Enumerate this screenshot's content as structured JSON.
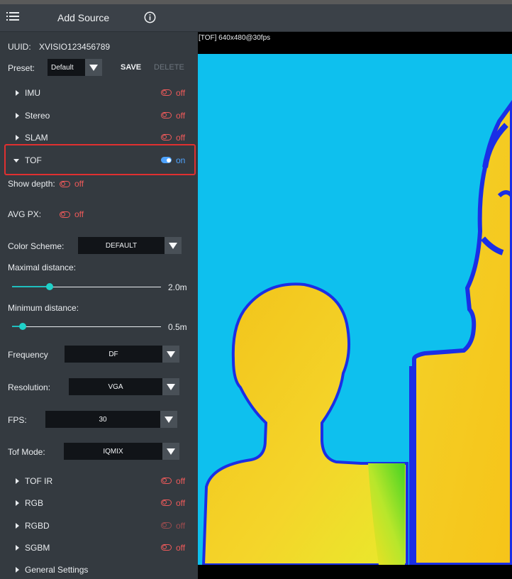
{
  "topbar": {
    "title": "Add Source"
  },
  "icons": {
    "menu": "hamburger-menu-icon",
    "info": "info-circle-icon"
  },
  "device": {
    "uuid_label": "UUID:",
    "uuid_value": "XVISIO123456789"
  },
  "preset": {
    "label": "Preset:",
    "value": "Default",
    "save": "SAVE",
    "delete": "DELETE"
  },
  "modules": {
    "imu": {
      "label": "IMU",
      "state": "off"
    },
    "stereo": {
      "label": "Stereo",
      "state": "off"
    },
    "slam": {
      "label": "SLAM",
      "state": "off"
    },
    "tof": {
      "label": "TOF",
      "state": "on"
    }
  },
  "tof_settings": {
    "show_depth": {
      "label": "Show depth:",
      "state": "off"
    },
    "avg_px": {
      "label": "AVG PX:",
      "state": "off"
    },
    "color_scheme": {
      "label": "Color Scheme:",
      "value": "DEFAULT"
    },
    "maximal_distance": {
      "label": "Maximal distance:",
      "value": "2.0m",
      "level": 0.25
    },
    "minimum_distance": {
      "label": "Minimum distance:",
      "value": "0.5m",
      "level": 0.07
    },
    "frequency": {
      "label": "Frequency",
      "value": "DF"
    },
    "resolution": {
      "label": "Resolution:",
      "value": "VGA"
    },
    "fps": {
      "label": "FPS:",
      "value": "30"
    },
    "tof_mode": {
      "label": "Tof Mode:",
      "value": "IQMIX"
    }
  },
  "more_modules": {
    "tof_ir": {
      "label": "TOF IR",
      "state": "off"
    },
    "rgb": {
      "label": "RGB",
      "state": "off"
    },
    "rgbd": {
      "label": "RGBD",
      "state": "off"
    },
    "sgbm": {
      "label": "SGBM",
      "state": "off"
    },
    "general": {
      "label": "General Settings"
    }
  },
  "viewer": {
    "stream_label": "[TOF]  640x480@30fps"
  },
  "colors": {
    "panel": "#343a40",
    "off": "#ef5a5a",
    "on": "#4ea3ff",
    "accent": "#1fd1c8",
    "highlight": "#e03030"
  }
}
